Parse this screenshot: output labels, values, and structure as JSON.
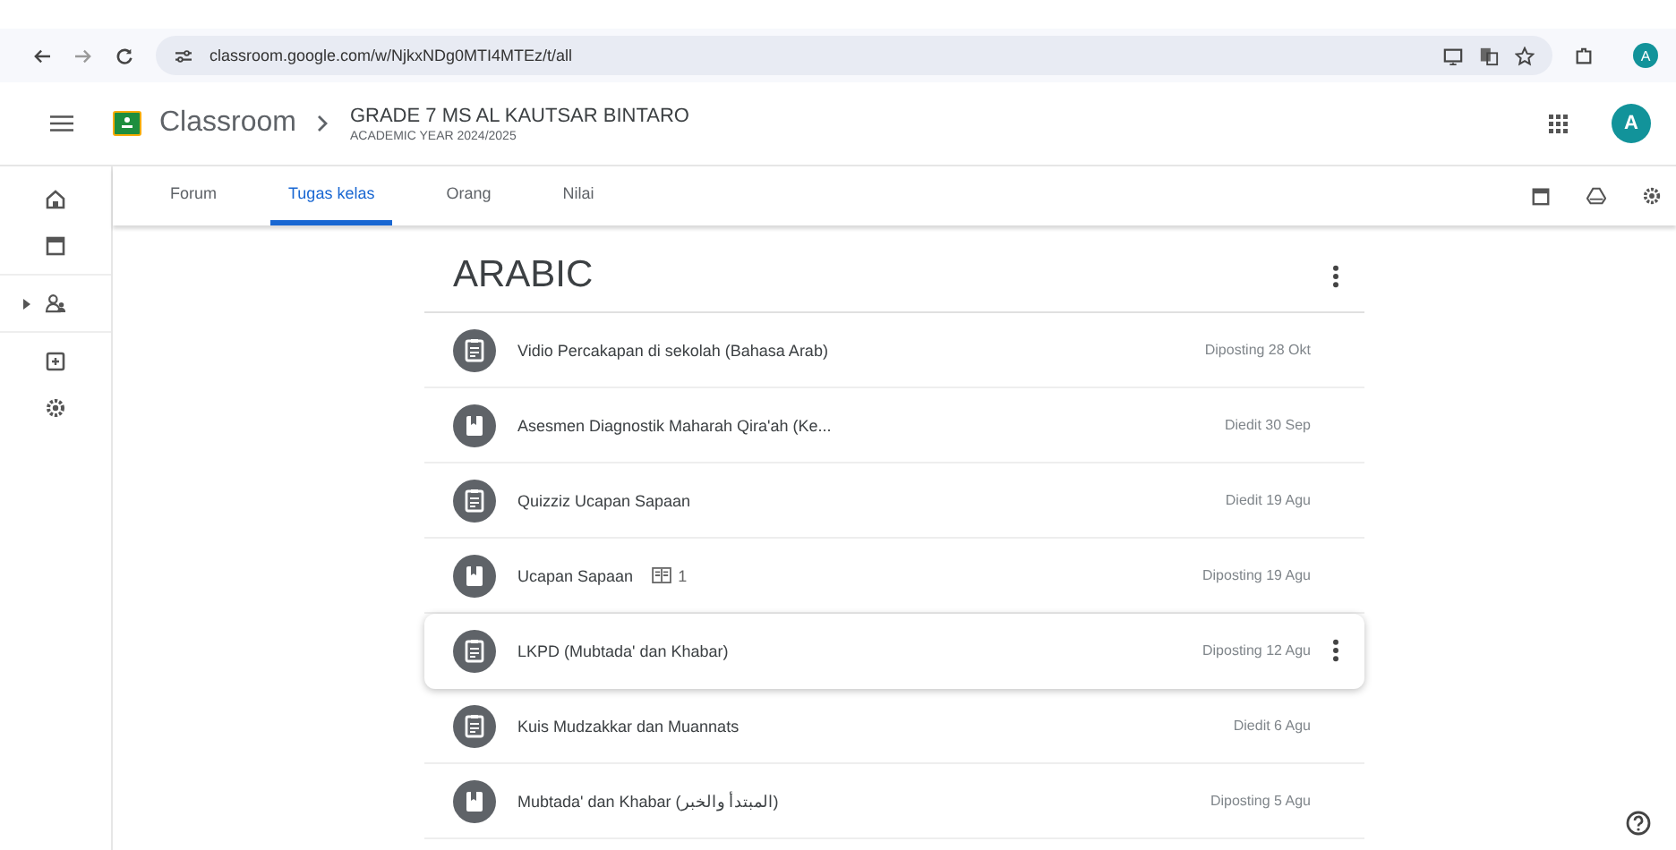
{
  "browser": {
    "url": "classroom.google.com/w/NjkxNDg0MTI4MTEz/t/all",
    "profile_initial": "A"
  },
  "header": {
    "app_name": "Classroom",
    "class_name": "GRADE 7 MS AL KAUTSAR BINTARO",
    "class_subtitle": "ACADEMIC YEAR 2024/2025",
    "account_initial": "A"
  },
  "tabs": [
    {
      "label": "Forum",
      "selected": false
    },
    {
      "label": "Tugas kelas",
      "selected": true
    },
    {
      "label": "Orang",
      "selected": false
    },
    {
      "label": "Nilai",
      "selected": false
    }
  ],
  "topic": {
    "title": "ARABIC"
  },
  "items": [
    {
      "kind": "assignment",
      "title": "Vidio Percakapan di sekolah (Bahasa Arab)",
      "date": "Diposting 28 Okt",
      "highlighted": false
    },
    {
      "kind": "material",
      "title": "Asesmen Diagnostik Maharah Qira'ah (Ke...",
      "date": "Diedit 30 Sep",
      "highlighted": false
    },
    {
      "kind": "assignment",
      "title": "Quizziz Ucapan Sapaan",
      "date": "Diedit 19 Agu",
      "highlighted": false
    },
    {
      "kind": "material",
      "title": "Ucapan Sapaan",
      "attachments": "1",
      "date": "Diposting 19 Agu",
      "highlighted": false
    },
    {
      "kind": "assignment",
      "title": "LKPD (Mubtada' dan Khabar)",
      "date": "Diposting 12 Agu",
      "highlighted": true
    },
    {
      "kind": "assignment",
      "title": "Kuis Mudzakkar dan Muannats",
      "date": "Diedit 6 Agu",
      "highlighted": false
    },
    {
      "kind": "material",
      "title": "Mubtada' dan Khabar (المبتدأ والخبر)",
      "date": "Diposting 5 Agu",
      "highlighted": false
    }
  ]
}
